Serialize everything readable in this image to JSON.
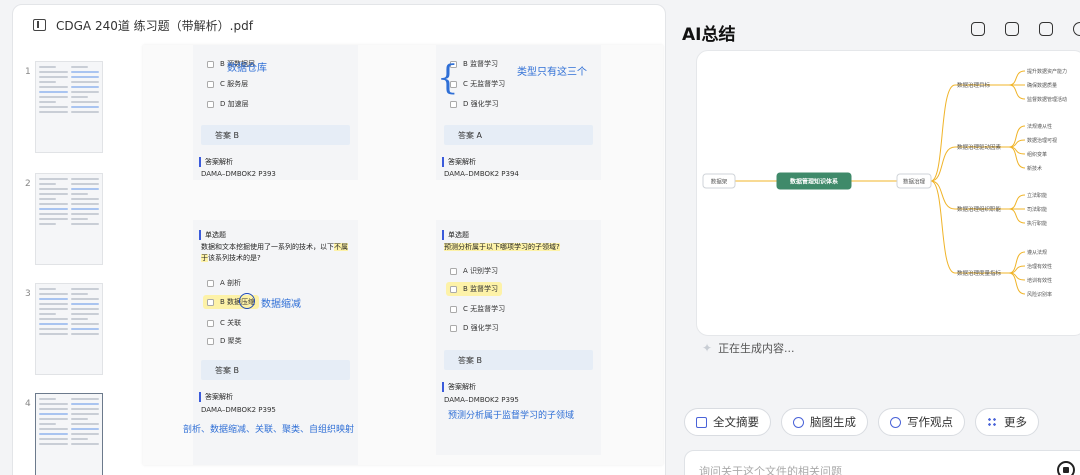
{
  "viewer": {
    "file_title": "CDGA 240道 练习题（带解析）.pdf",
    "pages": [
      {
        "num": "1"
      },
      {
        "num": "2"
      },
      {
        "num": "3"
      },
      {
        "num": "4"
      }
    ]
  },
  "pdf": {
    "q1": {
      "options": [
        "B  源数据层",
        "C  服务层",
        "D  加速层"
      ],
      "answer": "答案 B",
      "analysis_title": "答案解析",
      "analysis_text": "DAMA–DMBOK2 P393",
      "note": "数据仓库"
    },
    "q2": {
      "options": [
        "B  监督学习",
        "C  无监督学习",
        "D  强化学习"
      ],
      "answer": "答案 A",
      "analysis_title": "答案解析",
      "analysis_text": "DAMA–DMBOK2 P394",
      "note": "类型只有这三个"
    },
    "q3": {
      "type": "单选题",
      "question_pre": "数据和文本挖掘使用了一系列的技术，以下",
      "question_mark": "不属于",
      "question_post": "该系列技术的是?",
      "options": [
        "A  剖析",
        "B  数据压缩",
        "C  关联",
        "D  聚类"
      ],
      "answer": "答案 B",
      "analysis_title": "答案解析",
      "analysis_text": "DAMA–DMBOK2 P395",
      "note": "数据缩减",
      "note2": "剖析、数据缩减、关联、聚类、自组织映射"
    },
    "q4": {
      "type": "单选题",
      "question": "预测分析属于以下哪项学习的子领域?",
      "options": [
        "A  识别学习",
        "B  监督学习",
        "C  无监督学习",
        "D  强化学习"
      ],
      "answer": "答案 B",
      "analysis_title": "答案解析",
      "analysis_text": "DAMA–DMBOK2 P395",
      "note": "预测分析属于监督学习的子领域"
    }
  },
  "ai": {
    "title": "AI总结",
    "status": "正在生成内容...",
    "actions": {
      "summary": "全文摘要",
      "mindmap": "脑图生成",
      "writing": "写作观点",
      "more": "更多"
    },
    "ask_placeholder": "询问关于这个文件的相关问题"
  },
  "mindmap": {
    "root_left": "数据架",
    "center": "数据管理知识体系",
    "hub": "数据治理",
    "branches": [
      {
        "label": "数据治理目标",
        "leaves": [
          "提升数据资产能力",
          "确保数据质量",
          "监督数据管理活动"
        ]
      },
      {
        "label": "数据治理驱动因素",
        "leaves": [
          "法规遵从性",
          "数据治理可视",
          "组织变革",
          "新技术"
        ]
      },
      {
        "label": "数据治理组织职能",
        "leaves": [
          "立法职能",
          "司法职能",
          "执行职能"
        ]
      },
      {
        "label": "数据治理度量指标",
        "leaves": [
          "遵从法规",
          "治理有效性",
          "培训有效性",
          "风险识别率"
        ]
      }
    ],
    "colors": {
      "center": "#3f8a6a",
      "lines": "#f0b429"
    }
  }
}
